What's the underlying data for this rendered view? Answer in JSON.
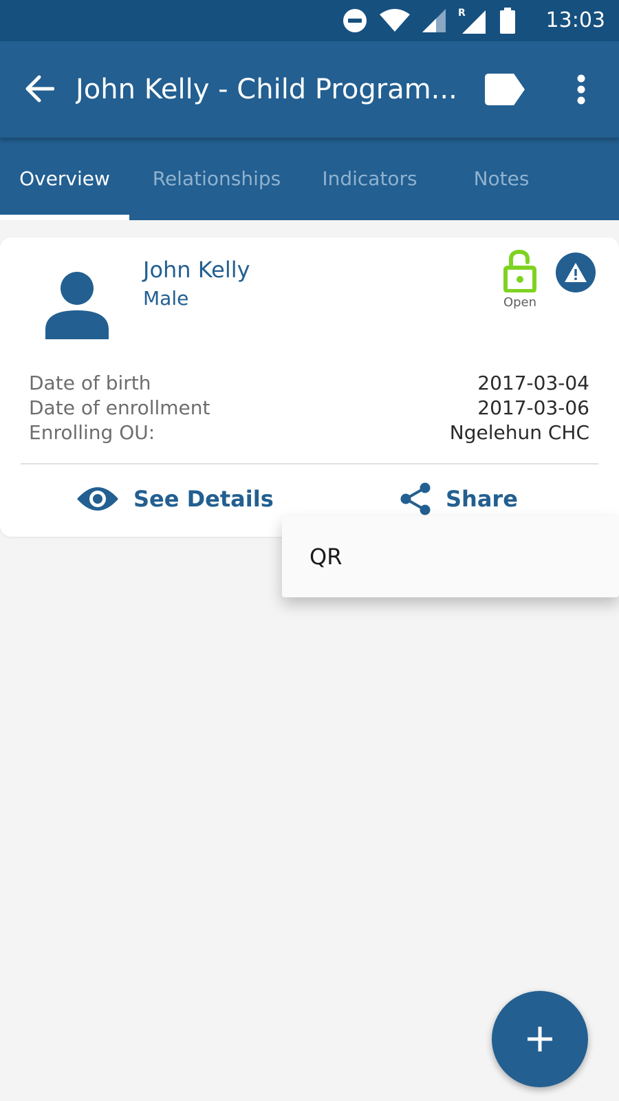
{
  "status_bar": {
    "time": "13:03",
    "icons": [
      "do-not-disturb-icon",
      "wifi-icon",
      "signal-icon",
      "roaming-signal-icon",
      "battery-icon"
    ]
  },
  "app_bar": {
    "title": "John Kelly - Child Program...",
    "back_icon": "arrow-back-icon",
    "label_icon": "label-icon",
    "more_icon": "more-vert-icon"
  },
  "tabs": [
    {
      "label": "Overview",
      "active": true
    },
    {
      "label": "Relationships",
      "active": false
    },
    {
      "label": "Indicators",
      "active": false
    },
    {
      "label": "Notes",
      "active": false
    }
  ],
  "card": {
    "name": "John Kelly",
    "sex": "Male",
    "status": "Open",
    "status_color": "#7ed321",
    "rows": [
      {
        "label": "Date of birth",
        "value": "2017-03-04"
      },
      {
        "label": "Date of enrollment",
        "value": "2017-03-06"
      },
      {
        "label": "Enrolling OU:",
        "value": "Ngelehun CHC"
      }
    ],
    "see_details_label": "See Details",
    "share_label": "Share"
  },
  "share_menu": {
    "items": [
      "QR"
    ]
  },
  "colors": {
    "primary": "#235f91",
    "status_bar": "#16507f",
    "background": "#f4f4f4"
  }
}
